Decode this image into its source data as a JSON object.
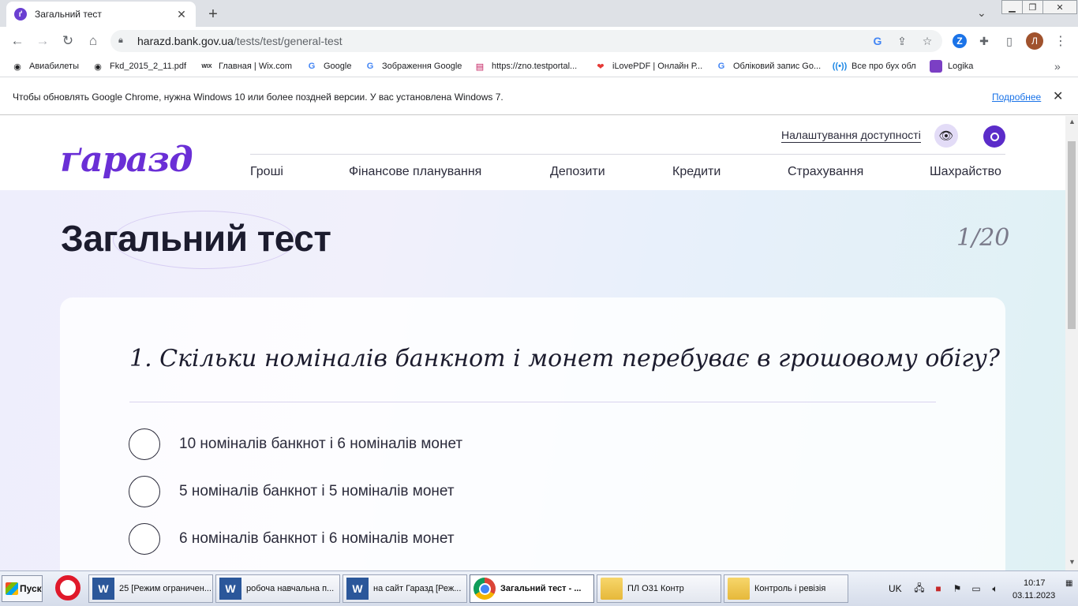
{
  "browser": {
    "tab_title": "Загальний тест",
    "tab_favicon": "ґ",
    "url_host": "harazd.bank.gov.ua",
    "url_path": "/tests/test/general-test",
    "profile_initial": "Л",
    "bookmarks": [
      {
        "label": "Авиабилеты",
        "icon": "globe-icon"
      },
      {
        "label": "Fkd_2015_2_11.pdf",
        "icon": "globe-icon"
      },
      {
        "label": "Главная | Wix.com",
        "icon": "wix-icon"
      },
      {
        "label": "Google",
        "icon": "google-icon"
      },
      {
        "label": "Зображення Google",
        "icon": "google-icon"
      },
      {
        "label": "https://zno.testportal...",
        "icon": "book-icon"
      },
      {
        "label": "iLovePDF | Онлайн Р...",
        "icon": "heart-icon"
      },
      {
        "label": "Обліковий запис Go...",
        "icon": "google-icon"
      },
      {
        "label": "Все про бух обл",
        "icon": "radio-icon"
      },
      {
        "label": "Logika",
        "icon": "logika-icon"
      }
    ],
    "infobar_message": "Чтобы обновлять Google Chrome, нужна Windows 10 или более поздней версии. У вас установлена Windows 7.",
    "infobar_link": "Подробнее"
  },
  "site": {
    "logo": "ґаразд",
    "accessibility_link": "Налаштування доступності",
    "nav": [
      "Гроші",
      "Фінансове планування",
      "Депозити",
      "Кредити",
      "Страхування",
      "Шахрайство"
    ],
    "accent_color": "#5b2cc9"
  },
  "test": {
    "title": "Загальний тест",
    "counter": "1/20",
    "question": "1. Скільки номіналів банкнот і монет перебуває в грошовому обігу?",
    "options": [
      "10 номіналів банкнот і 6 номіналів монет",
      "5 номіналів банкнот і 5 номіналів монет",
      "6 номіналів банкнот і 6 номіналів монет"
    ]
  },
  "taskbar": {
    "start_label": "Пуск",
    "tasks": [
      {
        "label": "25 [Режим ограничен...",
        "icon": "W"
      },
      {
        "label": "робоча навчальна п...",
        "icon": "W"
      },
      {
        "label": "на сайт Гаразд [Реж...",
        "icon": "W"
      },
      {
        "label": "Загальний тест - ...",
        "icon": ""
      },
      {
        "label": "ПЛ О31 Контр",
        "icon": ""
      },
      {
        "label": "Контроль і ревізія",
        "icon": ""
      }
    ],
    "language": "UK",
    "time": "10:17",
    "date": "03.11.2023"
  }
}
